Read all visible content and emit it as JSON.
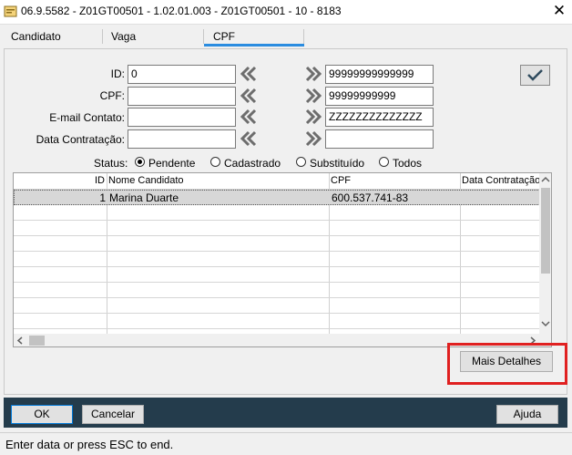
{
  "window": {
    "title": "06.9.5582 - Z01GT00501 - 1.02.01.003 - Z01GT00501 - 10 - 8183",
    "close_glyph": "✕"
  },
  "tabs": [
    {
      "label": "Candidato",
      "active": false
    },
    {
      "label": "Vaga",
      "active": false
    },
    {
      "label": "CPF",
      "active": true
    }
  ],
  "filters": {
    "id": {
      "label": "ID:",
      "from": "0",
      "to": "99999999999999"
    },
    "cpf": {
      "label": "CPF:",
      "from": "",
      "to": "99999999999"
    },
    "email": {
      "label": "E-mail Contato:",
      "from": "",
      "to": "ZZZZZZZZZZZZZZ"
    },
    "data": {
      "label": "Data Contratação:",
      "from": "",
      "to": ""
    }
  },
  "status": {
    "label": "Status:",
    "options": [
      {
        "label": "Pendente",
        "selected": true
      },
      {
        "label": "Cadastrado",
        "selected": false
      },
      {
        "label": "Substituído",
        "selected": false
      },
      {
        "label": "Todos",
        "selected": false
      }
    ]
  },
  "grid": {
    "columns": [
      "ID",
      "Nome Candidato",
      "CPF",
      "Data Contratação"
    ],
    "rows": [
      {
        "id": "1",
        "nome": "Marina Duarte",
        "cpf": "600.537.741-83",
        "data": ""
      }
    ]
  },
  "buttons": {
    "mais_detalhes": "Mais Detalhes",
    "ok": "OK",
    "cancelar": "Cancelar",
    "ajuda": "Ajuda"
  },
  "statusbar": {
    "text": "Enter data or press ESC to end."
  },
  "colors": {
    "accent": "#2a8ce0",
    "bottom_bar": "#243c4c",
    "highlight": "#e02020"
  }
}
